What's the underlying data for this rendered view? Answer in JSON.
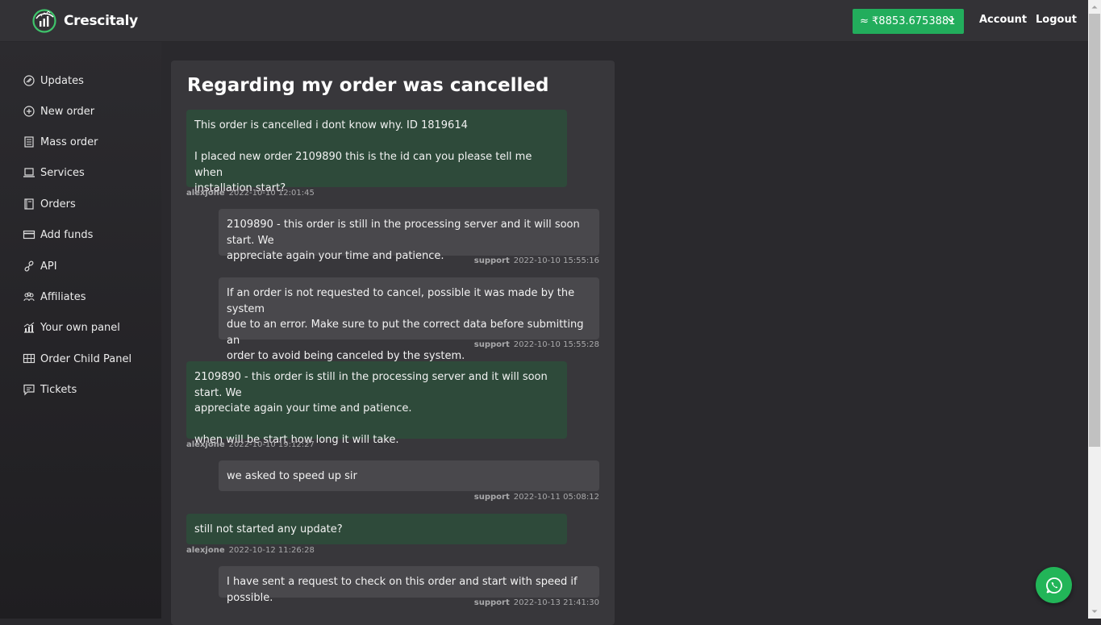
{
  "header": {
    "brand": "Crescitaly",
    "balance": "≈ ₹8853.6753881",
    "account_label": "Account",
    "logout_label": "Logout"
  },
  "sidebar": {
    "items": [
      {
        "label": "Updates",
        "icon": "updates-icon"
      },
      {
        "label": "New order",
        "icon": "plus-circle-icon"
      },
      {
        "label": "Mass order",
        "icon": "list-icon"
      },
      {
        "label": "Services",
        "icon": "laptop-icon"
      },
      {
        "label": "Orders",
        "icon": "book-icon"
      },
      {
        "label": "Add funds",
        "icon": "credit-card-icon"
      },
      {
        "label": "API",
        "icon": "link-icon"
      },
      {
        "label": "Affiliates",
        "icon": "users-icon"
      },
      {
        "label": "Your own panel",
        "icon": "chart-icon"
      },
      {
        "label": "Order Child Panel",
        "icon": "grid-icon"
      },
      {
        "label": "Tickets",
        "icon": "message-icon"
      }
    ]
  },
  "ticket": {
    "title": "Regarding my order was cancelled",
    "messages": [
      {
        "from": "user",
        "lines": [
          "This order is cancelled i dont know why. ID 1819614",
          "",
          "I placed new order 2109890 this is the id can you please tell me when",
          "installation start?"
        ],
        "author": "alexjone",
        "time": "2022-10-10 12:01:45"
      },
      {
        "from": "support",
        "lines": [
          "2109890 - this order is still in the processing server and it will soon start. We",
          "appreciate again your time and patience."
        ],
        "author": "support",
        "time": "2022-10-10 15:55:16"
      },
      {
        "from": "support",
        "lines": [
          "If an order is not requested to cancel, possible it was made by the system",
          "due to an error. Make sure to put the correct data before submitting an",
          "order to avoid being canceled by the system."
        ],
        "author": "support",
        "time": "2022-10-10 15:55:28"
      },
      {
        "from": "user",
        "lines": [
          "2109890 - this order is still in the processing server and it will soon start. We",
          "appreciate again your time and patience.",
          "",
          "when will be start how long it will take."
        ],
        "author": "alexjone",
        "time": "2022-10-10 19:12:27"
      },
      {
        "from": "support",
        "lines": [
          "we asked to speed up sir"
        ],
        "author": "support",
        "time": "2022-10-11 05:08:12"
      },
      {
        "from": "user",
        "lines": [
          "still not started any update?"
        ],
        "author": "alexjone",
        "time": "2022-10-12 11:26:28"
      },
      {
        "from": "support",
        "lines": [
          "I have sent a request to check on this order and start with speed if possible."
        ],
        "author": "support",
        "time": "2022-10-13 21:41:30"
      }
    ]
  },
  "colors": {
    "user_bubble": "#2e4a3a",
    "support_bubble": "#49484c",
    "accent": "#22ad5c",
    "whatsapp": "#22b558"
  }
}
